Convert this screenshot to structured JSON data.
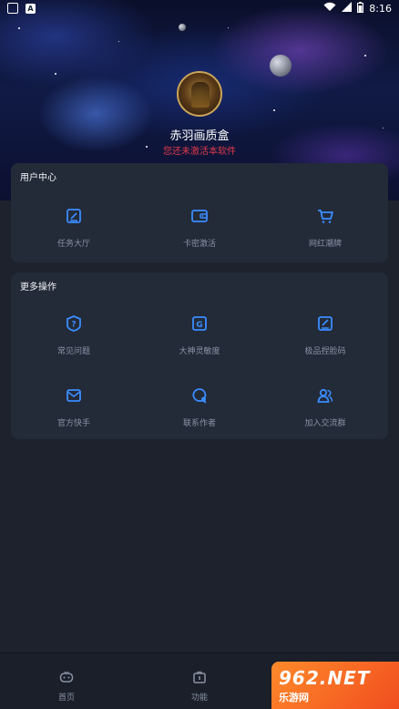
{
  "status_bar": {
    "time": "8:16"
  },
  "profile": {
    "name": "赤羽画质盒",
    "subtitle": "您还未激活本软件"
  },
  "user_center": {
    "title": "用户中心",
    "items": [
      {
        "label": "任务大厅",
        "icon": "task-icon"
      },
      {
        "label": "卡密激活",
        "icon": "wallet-icon"
      },
      {
        "label": "网红潮牌",
        "icon": "cart-icon"
      }
    ]
  },
  "more_actions": {
    "title": "更多操作",
    "items": [
      {
        "label": "常见问题",
        "icon": "question-icon"
      },
      {
        "label": "大神灵敏度",
        "icon": "g-icon"
      },
      {
        "label": "极品捏脸码",
        "icon": "edit-icon"
      },
      {
        "label": "官方快手",
        "icon": "mail-icon"
      },
      {
        "label": "联系作者",
        "icon": "chat-icon"
      },
      {
        "label": "加入交流群",
        "icon": "group-icon"
      }
    ]
  },
  "tabbar": {
    "items": [
      {
        "label": "首页",
        "icon": "home-icon"
      },
      {
        "label": "功能",
        "icon": "toolbox-icon"
      }
    ]
  },
  "watermark": {
    "top": "962.NET",
    "bottom": "乐游网"
  },
  "colors": {
    "accent": "#3a8dff",
    "background": "#1d222d",
    "card": "#232a38",
    "alert": "#e23a4a"
  }
}
